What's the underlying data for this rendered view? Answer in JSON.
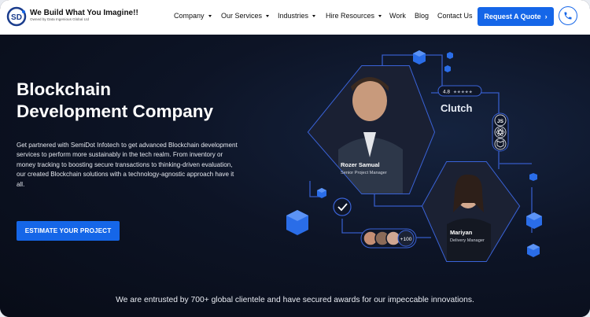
{
  "nav": {
    "brand_title": "We Build What You Imagine!!",
    "brand_sub": "Owned by Data Ingenious Global Ltd",
    "items": [
      {
        "label": "Company",
        "dropdown": true
      },
      {
        "label": "Our Services",
        "dropdown": true
      },
      {
        "label": "Industries",
        "dropdown": true
      },
      {
        "label": "Hire Resources",
        "dropdown": true
      },
      {
        "label": "Work",
        "dropdown": false
      },
      {
        "label": "Blog",
        "dropdown": false
      },
      {
        "label": "Contact Us",
        "dropdown": false
      }
    ],
    "cta_label": "Request A Quote",
    "phone_icon": "phone-icon"
  },
  "hero": {
    "title_line1": "Blockchain",
    "title_line2": "Development Company",
    "description": "Get partnered with SemiDot Infotech to get advanced Blockchain development services to perform more sustainably in the tech realm. From inventory or money tracking to boosting secure transactions to thinking-driven evaluation, our created Blockchain solutions with a technology-agnostic approach have it all.",
    "button_label": "ESTIMATE YOUR PROJECT"
  },
  "graphic": {
    "person1_name": "Rozer Samual",
    "person1_role": "Senior Project Manager",
    "person2_name": "Mariyan",
    "person2_role": "Delivery Manager",
    "rating": "4.8",
    "rating_brand": "Clutch",
    "tech_js": "JS",
    "team_count": "+100"
  },
  "footer_text": "We are entrusted by 700+ global clientele and have secured awards for our impeccable innovations.",
  "colors": {
    "accent": "#1566e8",
    "background": "#0b1020",
    "line": "#3a63d8"
  }
}
